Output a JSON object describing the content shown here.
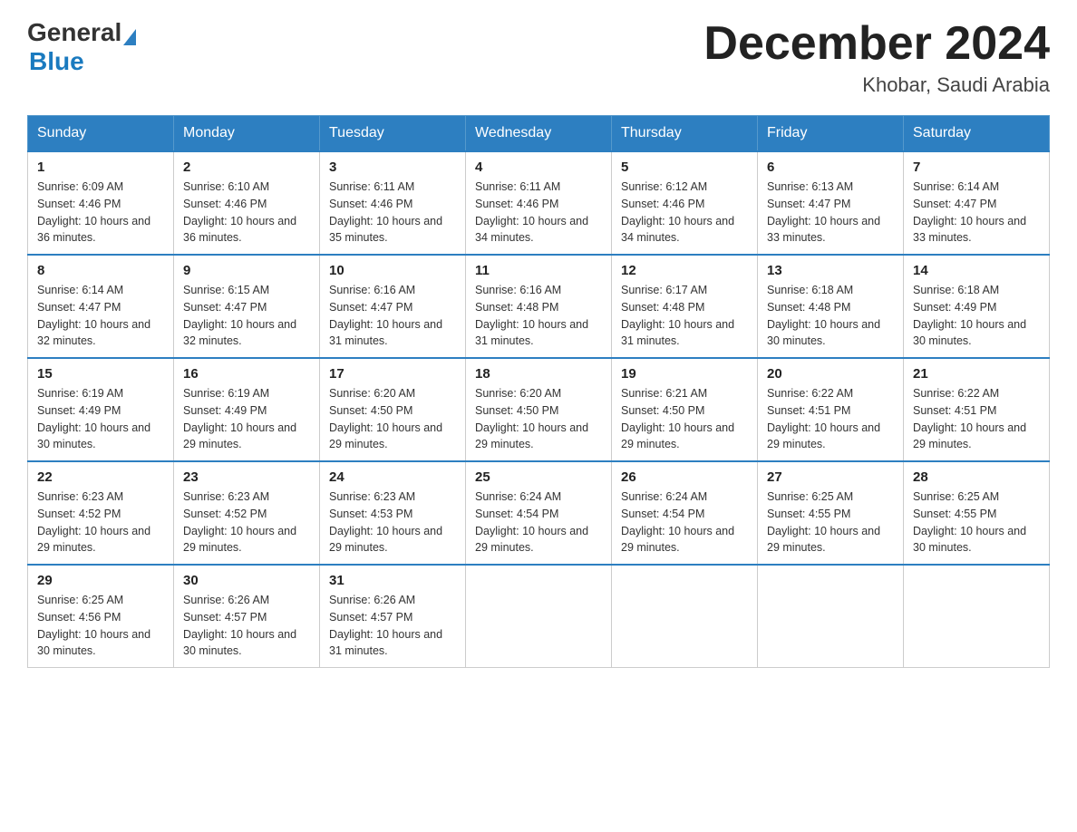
{
  "header": {
    "logo_general": "General",
    "logo_blue": "Blue",
    "month_title": "December 2024",
    "location": "Khobar, Saudi Arabia"
  },
  "calendar": {
    "days_of_week": [
      "Sunday",
      "Monday",
      "Tuesday",
      "Wednesday",
      "Thursday",
      "Friday",
      "Saturday"
    ],
    "weeks": [
      [
        {
          "day": "1",
          "sunrise": "6:09 AM",
          "sunset": "4:46 PM",
          "daylight": "10 hours and 36 minutes."
        },
        {
          "day": "2",
          "sunrise": "6:10 AM",
          "sunset": "4:46 PM",
          "daylight": "10 hours and 36 minutes."
        },
        {
          "day": "3",
          "sunrise": "6:11 AM",
          "sunset": "4:46 PM",
          "daylight": "10 hours and 35 minutes."
        },
        {
          "day": "4",
          "sunrise": "6:11 AM",
          "sunset": "4:46 PM",
          "daylight": "10 hours and 34 minutes."
        },
        {
          "day": "5",
          "sunrise": "6:12 AM",
          "sunset": "4:46 PM",
          "daylight": "10 hours and 34 minutes."
        },
        {
          "day": "6",
          "sunrise": "6:13 AM",
          "sunset": "4:47 PM",
          "daylight": "10 hours and 33 minutes."
        },
        {
          "day": "7",
          "sunrise": "6:14 AM",
          "sunset": "4:47 PM",
          "daylight": "10 hours and 33 minutes."
        }
      ],
      [
        {
          "day": "8",
          "sunrise": "6:14 AM",
          "sunset": "4:47 PM",
          "daylight": "10 hours and 32 minutes."
        },
        {
          "day": "9",
          "sunrise": "6:15 AM",
          "sunset": "4:47 PM",
          "daylight": "10 hours and 32 minutes."
        },
        {
          "day": "10",
          "sunrise": "6:16 AM",
          "sunset": "4:47 PM",
          "daylight": "10 hours and 31 minutes."
        },
        {
          "day": "11",
          "sunrise": "6:16 AM",
          "sunset": "4:48 PM",
          "daylight": "10 hours and 31 minutes."
        },
        {
          "day": "12",
          "sunrise": "6:17 AM",
          "sunset": "4:48 PM",
          "daylight": "10 hours and 31 minutes."
        },
        {
          "day": "13",
          "sunrise": "6:18 AM",
          "sunset": "4:48 PM",
          "daylight": "10 hours and 30 minutes."
        },
        {
          "day": "14",
          "sunrise": "6:18 AM",
          "sunset": "4:49 PM",
          "daylight": "10 hours and 30 minutes."
        }
      ],
      [
        {
          "day": "15",
          "sunrise": "6:19 AM",
          "sunset": "4:49 PM",
          "daylight": "10 hours and 30 minutes."
        },
        {
          "day": "16",
          "sunrise": "6:19 AM",
          "sunset": "4:49 PM",
          "daylight": "10 hours and 29 minutes."
        },
        {
          "day": "17",
          "sunrise": "6:20 AM",
          "sunset": "4:50 PM",
          "daylight": "10 hours and 29 minutes."
        },
        {
          "day": "18",
          "sunrise": "6:20 AM",
          "sunset": "4:50 PM",
          "daylight": "10 hours and 29 minutes."
        },
        {
          "day": "19",
          "sunrise": "6:21 AM",
          "sunset": "4:50 PM",
          "daylight": "10 hours and 29 minutes."
        },
        {
          "day": "20",
          "sunrise": "6:22 AM",
          "sunset": "4:51 PM",
          "daylight": "10 hours and 29 minutes."
        },
        {
          "day": "21",
          "sunrise": "6:22 AM",
          "sunset": "4:51 PM",
          "daylight": "10 hours and 29 minutes."
        }
      ],
      [
        {
          "day": "22",
          "sunrise": "6:23 AM",
          "sunset": "4:52 PM",
          "daylight": "10 hours and 29 minutes."
        },
        {
          "day": "23",
          "sunrise": "6:23 AM",
          "sunset": "4:52 PM",
          "daylight": "10 hours and 29 minutes."
        },
        {
          "day": "24",
          "sunrise": "6:23 AM",
          "sunset": "4:53 PM",
          "daylight": "10 hours and 29 minutes."
        },
        {
          "day": "25",
          "sunrise": "6:24 AM",
          "sunset": "4:54 PM",
          "daylight": "10 hours and 29 minutes."
        },
        {
          "day": "26",
          "sunrise": "6:24 AM",
          "sunset": "4:54 PM",
          "daylight": "10 hours and 29 minutes."
        },
        {
          "day": "27",
          "sunrise": "6:25 AM",
          "sunset": "4:55 PM",
          "daylight": "10 hours and 29 minutes."
        },
        {
          "day": "28",
          "sunrise": "6:25 AM",
          "sunset": "4:55 PM",
          "daylight": "10 hours and 30 minutes."
        }
      ],
      [
        {
          "day": "29",
          "sunrise": "6:25 AM",
          "sunset": "4:56 PM",
          "daylight": "10 hours and 30 minutes."
        },
        {
          "day": "30",
          "sunrise": "6:26 AM",
          "sunset": "4:57 PM",
          "daylight": "10 hours and 30 minutes."
        },
        {
          "day": "31",
          "sunrise": "6:26 AM",
          "sunset": "4:57 PM",
          "daylight": "10 hours and 31 minutes."
        },
        null,
        null,
        null,
        null
      ]
    ]
  }
}
